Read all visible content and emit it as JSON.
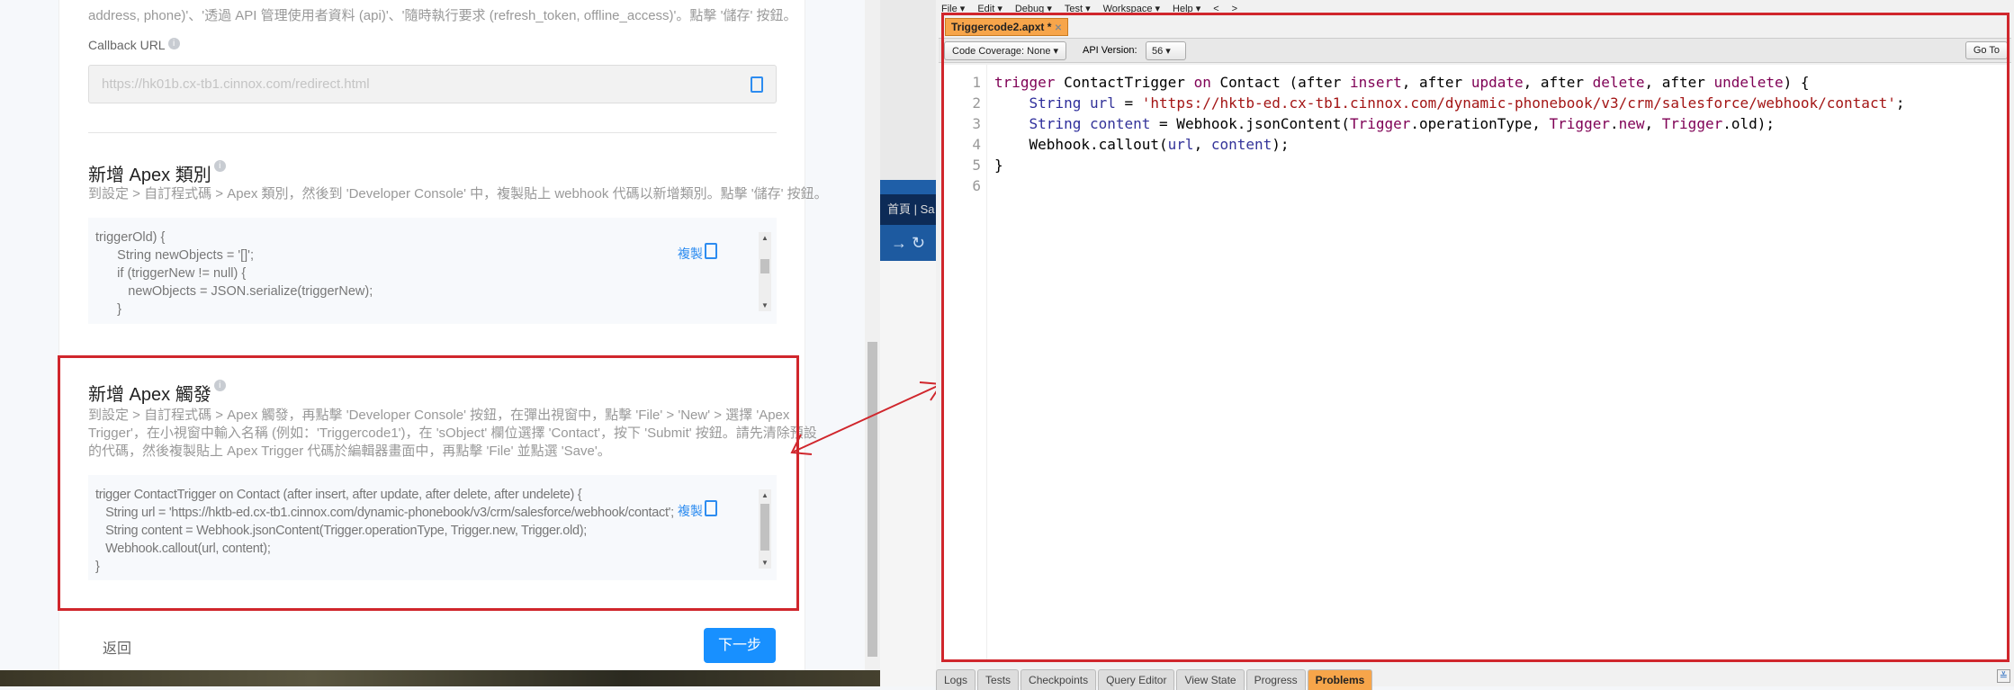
{
  "left": {
    "top_text": "address, phone)'、'透過 API 管理使用者資料 (api)'、'隨時執行要求 (refresh_token, offline_access)'。點擊 '儲存' 按鈕。",
    "callback_label": "Callback URL",
    "callback_url": "https://hk01b.cx-tb1.cinnox.com/redirect.html",
    "apex_class": {
      "title": "新增 Apex 類別",
      "desc": "到設定 > 自訂程式碼 > Apex 類別，然後到 'Developer Console' 中，複製貼上 webhook 代碼以新增類別。點擊 '儲存' 按鈕。",
      "code": "triggerOld) {\n      String newObjects = '[]';\n      if (triggerNew != null) {\n         newObjects = JSON.serialize(triggerNew);\n      }",
      "copy_label": "複製"
    },
    "apex_trigger": {
      "title": "新增 Apex 觸發",
      "desc_lines": [
        "到設定 > 自訂程式碼 > Apex 觸發，再點擊 'Developer Console' 按鈕，在彈出視窗中，點擊 'File' > 'New' > 選擇 'Apex",
        "Trigger'，在小視窗中輸入名稱 (例如：'Triggercode1')，在 'sObject' 欄位選擇 'Contact'，按下 'Submit' 按鈕。請先清除預設",
        "的代碼，然後複製貼上 Apex Trigger 代碼於編輯器畫面中，再點擊 'File' 並點選 'Save'。"
      ],
      "code": "trigger ContactTrigger on Contact (after insert, after update, after delete, after undelete) {\n   String url = 'https://hktb-ed.cx-tb1.cinnox.com/dynamic-phonebook/v3/crm/salesforce/webhook/contact';\n   String content = Webhook.jsonContent(Trigger.operationType, Trigger.new, Trigger.old);\n   Webhook.callout(url, content);\n}",
      "copy_label": "複製"
    },
    "back_label": "返回",
    "next_label": "下一步"
  },
  "browser_bg": {
    "tab_text": "首頁 | Sa"
  },
  "console": {
    "menu": [
      "File ▾",
      "Edit ▾",
      "Debug ▾",
      "Test ▾",
      "Workspace ▾",
      "Help ▾",
      "<",
      ">"
    ],
    "file_tab": "Triggercode2.apxt *",
    "code_coverage": "Code Coverage: None ▾",
    "api_version_label": "API Version:",
    "api_version": "56",
    "goto_label": "Go To",
    "line_numbers": [
      "1",
      "2",
      "3",
      "4",
      "5",
      "6"
    ],
    "bottom_tabs": [
      "Logs",
      "Tests",
      "Checkpoints",
      "Query Editor",
      "View State",
      "Progress",
      "Problems"
    ],
    "active_bottom_tab": "Problems"
  },
  "colors": {
    "annotation": "#d0262c",
    "primary": "#1890ff",
    "tab_active": "#f7a54a"
  }
}
